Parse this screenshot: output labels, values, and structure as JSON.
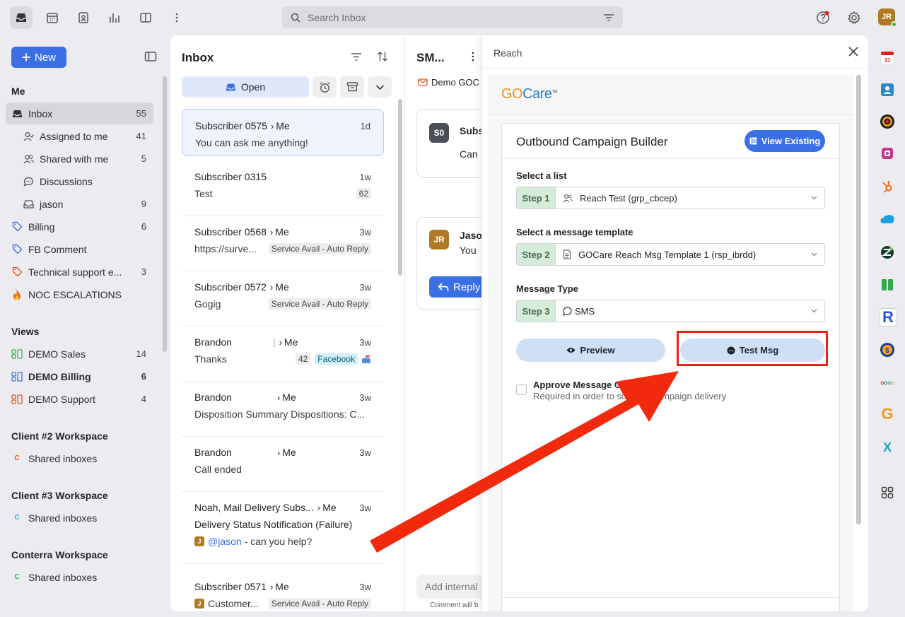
{
  "topbar": {
    "search_placeholder": "Search Inbox",
    "user_initials": "JR"
  },
  "sidebar": {
    "new_label": "New",
    "me_heading": "Me",
    "me_items": [
      {
        "label": "Inbox",
        "count": "55",
        "icon": "inbox-icon"
      },
      {
        "label": "Assigned to me",
        "count": "41",
        "icon": "user-assigned-icon"
      },
      {
        "label": "Shared with me",
        "count": "5",
        "icon": "users-icon"
      },
      {
        "label": "Discussions",
        "count": "",
        "icon": "chat-icon"
      },
      {
        "label": "jason",
        "count": "9",
        "icon": "inbox-icon"
      },
      {
        "label": "Billing",
        "count": "6",
        "icon": "tag-icon"
      },
      {
        "label": "FB Comment",
        "count": "",
        "icon": "tag-icon"
      },
      {
        "label": "Technical support e...",
        "count": "3",
        "icon": "tag-icon"
      },
      {
        "label": "NOC ESCALATIONS",
        "count": "",
        "icon": "fire-icon"
      }
    ],
    "views_heading": "Views",
    "views": [
      {
        "label": "DEMO Sales",
        "count": "14"
      },
      {
        "label": "DEMO Billing",
        "count": "6"
      },
      {
        "label": "DEMO Support",
        "count": "4"
      }
    ],
    "workspaces": [
      {
        "heading": "Client #2 Workspace",
        "item": "Shared inboxes",
        "color": "#e2541b"
      },
      {
        "heading": "Client #3 Workspace",
        "item": "Shared inboxes",
        "color": "#28b5d8"
      },
      {
        "heading": "Conterra Workspace",
        "item": "Shared inboxes",
        "color": "#2fb34a"
      }
    ]
  },
  "inbox": {
    "title": "Inbox",
    "open_label": "Open",
    "conversations": [
      {
        "sender": "Subscriber 0575",
        "to": "Me",
        "time": "1d",
        "preview": "You can ask me anything!",
        "tag": "",
        "num": ""
      },
      {
        "sender": "Subscriber 0315",
        "to": "",
        "time": "1w",
        "preview": "Test",
        "tag": "",
        "num": "62"
      },
      {
        "sender": "Subscriber 0568",
        "to": "Me",
        "time": "3w",
        "preview": "https://surve...",
        "tag": "Service Avail - Auto Reply",
        "num": ""
      },
      {
        "sender": "Subscriber 0572",
        "to": "Me",
        "time": "3w",
        "preview": "Gogig",
        "tag": "Service Avail - Auto Reply",
        "num": ""
      },
      {
        "sender": "Brandon",
        "to": "Me",
        "time": "3w",
        "preview": "Thanks",
        "tag": "Facebook",
        "num": "42"
      },
      {
        "sender": "Brandon",
        "to": "Me",
        "time": "3w",
        "preview": "Disposition Summary Dispositions: C...",
        "tag": "",
        "num": ""
      },
      {
        "sender": "Brandon",
        "to": "Me",
        "time": "3w",
        "preview": "Call ended",
        "tag": "",
        "num": ""
      },
      {
        "sender": "Noah, Mail Delivery Subs...",
        "to": "Me",
        "time": "3w",
        "preview": "Delivery Status Notification (Failure)",
        "tag": "",
        "num": ""
      },
      {
        "sender": "Subscriber 0571",
        "to": "Me",
        "time": "3w",
        "preview": "Customer...",
        "tag": "Service Avail - Auto Reply",
        "num": ""
      }
    ],
    "mention": {
      "badge": "J",
      "handle": "@jason",
      "text": " - can you help?"
    },
    "last_badge": "J"
  },
  "conversation": {
    "title": "SM...",
    "channel": "Demo GOC",
    "msg1_avatar": "S0",
    "msg1_name": "Subs",
    "msg1_text": "Can",
    "msg2_avatar": "JR",
    "msg2_name": "Jaso",
    "msg2_text": "You",
    "reply_label": "Reply",
    "note_placeholder": "Add internal",
    "note_hint": "Comment will b"
  },
  "reach": {
    "title": "Reach",
    "logo_go": "GO",
    "logo_care": "Care",
    "logo_tm": "TM",
    "builder_title": "Outbound Campaign Builder",
    "view_existing": "View Existing",
    "fields": [
      {
        "label": "Select a list",
        "step": "Step 1",
        "value": "Reach Test (grp_cbcep)"
      },
      {
        "label": "Select a message template",
        "step": "Step 2",
        "value": "GOCare Reach Msg Template 1 (rsp_ibrdd)"
      },
      {
        "label": "Message Type",
        "step": "Step 3",
        "value": "SMS"
      }
    ],
    "preview_label": "Preview",
    "test_label": "Test Msg",
    "approve_title": "Approve Message Cont",
    "approve_desc": "Required in order to sch            mpaign delivery"
  },
  "colors": {
    "accent": "#3b6fe6",
    "annotation_red": "#e8231a"
  }
}
